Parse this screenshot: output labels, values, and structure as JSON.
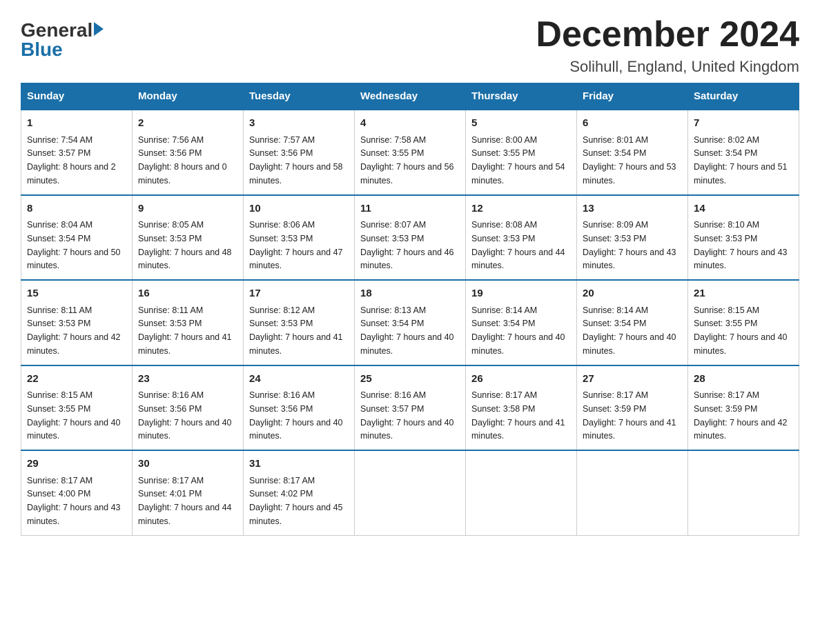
{
  "header": {
    "logo_general": "General",
    "logo_blue": "Blue",
    "title": "December 2024",
    "subtitle": "Solihull, England, United Kingdom"
  },
  "days_of_week": [
    "Sunday",
    "Monday",
    "Tuesday",
    "Wednesday",
    "Thursday",
    "Friday",
    "Saturday"
  ],
  "weeks": [
    [
      {
        "day": "1",
        "sunrise": "Sunrise: 7:54 AM",
        "sunset": "Sunset: 3:57 PM",
        "daylight": "Daylight: 8 hours and 2 minutes."
      },
      {
        "day": "2",
        "sunrise": "Sunrise: 7:56 AM",
        "sunset": "Sunset: 3:56 PM",
        "daylight": "Daylight: 8 hours and 0 minutes."
      },
      {
        "day": "3",
        "sunrise": "Sunrise: 7:57 AM",
        "sunset": "Sunset: 3:56 PM",
        "daylight": "Daylight: 7 hours and 58 minutes."
      },
      {
        "day": "4",
        "sunrise": "Sunrise: 7:58 AM",
        "sunset": "Sunset: 3:55 PM",
        "daylight": "Daylight: 7 hours and 56 minutes."
      },
      {
        "day": "5",
        "sunrise": "Sunrise: 8:00 AM",
        "sunset": "Sunset: 3:55 PM",
        "daylight": "Daylight: 7 hours and 54 minutes."
      },
      {
        "day": "6",
        "sunrise": "Sunrise: 8:01 AM",
        "sunset": "Sunset: 3:54 PM",
        "daylight": "Daylight: 7 hours and 53 minutes."
      },
      {
        "day": "7",
        "sunrise": "Sunrise: 8:02 AM",
        "sunset": "Sunset: 3:54 PM",
        "daylight": "Daylight: 7 hours and 51 minutes."
      }
    ],
    [
      {
        "day": "8",
        "sunrise": "Sunrise: 8:04 AM",
        "sunset": "Sunset: 3:54 PM",
        "daylight": "Daylight: 7 hours and 50 minutes."
      },
      {
        "day": "9",
        "sunrise": "Sunrise: 8:05 AM",
        "sunset": "Sunset: 3:53 PM",
        "daylight": "Daylight: 7 hours and 48 minutes."
      },
      {
        "day": "10",
        "sunrise": "Sunrise: 8:06 AM",
        "sunset": "Sunset: 3:53 PM",
        "daylight": "Daylight: 7 hours and 47 minutes."
      },
      {
        "day": "11",
        "sunrise": "Sunrise: 8:07 AM",
        "sunset": "Sunset: 3:53 PM",
        "daylight": "Daylight: 7 hours and 46 minutes."
      },
      {
        "day": "12",
        "sunrise": "Sunrise: 8:08 AM",
        "sunset": "Sunset: 3:53 PM",
        "daylight": "Daylight: 7 hours and 44 minutes."
      },
      {
        "day": "13",
        "sunrise": "Sunrise: 8:09 AM",
        "sunset": "Sunset: 3:53 PM",
        "daylight": "Daylight: 7 hours and 43 minutes."
      },
      {
        "day": "14",
        "sunrise": "Sunrise: 8:10 AM",
        "sunset": "Sunset: 3:53 PM",
        "daylight": "Daylight: 7 hours and 43 minutes."
      }
    ],
    [
      {
        "day": "15",
        "sunrise": "Sunrise: 8:11 AM",
        "sunset": "Sunset: 3:53 PM",
        "daylight": "Daylight: 7 hours and 42 minutes."
      },
      {
        "day": "16",
        "sunrise": "Sunrise: 8:11 AM",
        "sunset": "Sunset: 3:53 PM",
        "daylight": "Daylight: 7 hours and 41 minutes."
      },
      {
        "day": "17",
        "sunrise": "Sunrise: 8:12 AM",
        "sunset": "Sunset: 3:53 PM",
        "daylight": "Daylight: 7 hours and 41 minutes."
      },
      {
        "day": "18",
        "sunrise": "Sunrise: 8:13 AM",
        "sunset": "Sunset: 3:54 PM",
        "daylight": "Daylight: 7 hours and 40 minutes."
      },
      {
        "day": "19",
        "sunrise": "Sunrise: 8:14 AM",
        "sunset": "Sunset: 3:54 PM",
        "daylight": "Daylight: 7 hours and 40 minutes."
      },
      {
        "day": "20",
        "sunrise": "Sunrise: 8:14 AM",
        "sunset": "Sunset: 3:54 PM",
        "daylight": "Daylight: 7 hours and 40 minutes."
      },
      {
        "day": "21",
        "sunrise": "Sunrise: 8:15 AM",
        "sunset": "Sunset: 3:55 PM",
        "daylight": "Daylight: 7 hours and 40 minutes."
      }
    ],
    [
      {
        "day": "22",
        "sunrise": "Sunrise: 8:15 AM",
        "sunset": "Sunset: 3:55 PM",
        "daylight": "Daylight: 7 hours and 40 minutes."
      },
      {
        "day": "23",
        "sunrise": "Sunrise: 8:16 AM",
        "sunset": "Sunset: 3:56 PM",
        "daylight": "Daylight: 7 hours and 40 minutes."
      },
      {
        "day": "24",
        "sunrise": "Sunrise: 8:16 AM",
        "sunset": "Sunset: 3:56 PM",
        "daylight": "Daylight: 7 hours and 40 minutes."
      },
      {
        "day": "25",
        "sunrise": "Sunrise: 8:16 AM",
        "sunset": "Sunset: 3:57 PM",
        "daylight": "Daylight: 7 hours and 40 minutes."
      },
      {
        "day": "26",
        "sunrise": "Sunrise: 8:17 AM",
        "sunset": "Sunset: 3:58 PM",
        "daylight": "Daylight: 7 hours and 41 minutes."
      },
      {
        "day": "27",
        "sunrise": "Sunrise: 8:17 AM",
        "sunset": "Sunset: 3:59 PM",
        "daylight": "Daylight: 7 hours and 41 minutes."
      },
      {
        "day": "28",
        "sunrise": "Sunrise: 8:17 AM",
        "sunset": "Sunset: 3:59 PM",
        "daylight": "Daylight: 7 hours and 42 minutes."
      }
    ],
    [
      {
        "day": "29",
        "sunrise": "Sunrise: 8:17 AM",
        "sunset": "Sunset: 4:00 PM",
        "daylight": "Daylight: 7 hours and 43 minutes."
      },
      {
        "day": "30",
        "sunrise": "Sunrise: 8:17 AM",
        "sunset": "Sunset: 4:01 PM",
        "daylight": "Daylight: 7 hours and 44 minutes."
      },
      {
        "day": "31",
        "sunrise": "Sunrise: 8:17 AM",
        "sunset": "Sunset: 4:02 PM",
        "daylight": "Daylight: 7 hours and 45 minutes."
      },
      null,
      null,
      null,
      null
    ]
  ]
}
